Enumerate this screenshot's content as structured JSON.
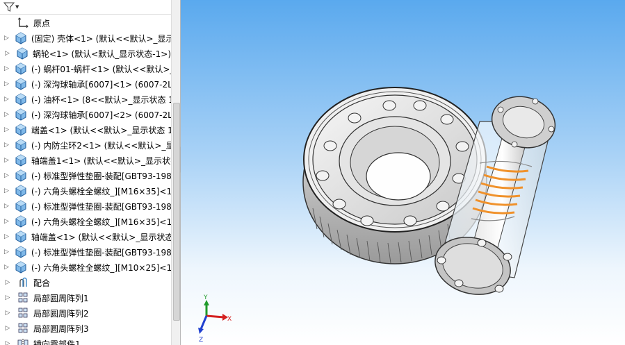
{
  "filter": {
    "icon": "filter-icon"
  },
  "tree": {
    "items": [
      {
        "label": "原点",
        "icon": "origin-icon",
        "expandable": false
      },
      {
        "label": "(固定) 壳体<1> (默认<<默认>_显示",
        "icon": "part-icon",
        "expandable": true
      },
      {
        "label": "蜗轮<1> (默认<默认_显示状态-1>)",
        "icon": "part-icon",
        "expandable": true
      },
      {
        "label": "(-) 蜗杆01-蜗杆<1> (默认<<默认>_",
        "icon": "part-icon",
        "expandable": true
      },
      {
        "label": "(-) 深沟球轴承[6007]<1> (6007-2LS",
        "icon": "part-icon",
        "expandable": true
      },
      {
        "label": "(-) 油杯<1> (8<<默认>_显示状态 1",
        "icon": "part-icon",
        "expandable": true
      },
      {
        "label": "(-) 深沟球轴承[6007]<2> (6007-2LS",
        "icon": "part-icon",
        "expandable": true
      },
      {
        "label": "端盖<1> (默认<<默认>_显示状态 1",
        "icon": "part-icon",
        "expandable": true
      },
      {
        "label": "(-) 内防尘环2<1> (默认<<默认>_显",
        "icon": "part-icon",
        "expandable": true
      },
      {
        "label": "轴端盖1<1> (默认<<默认>_显示状态",
        "icon": "part-icon",
        "expandable": true
      },
      {
        "label": "(-) 标准型弹性垫圈-装配[GBT93-198",
        "icon": "part-icon",
        "expandable": true
      },
      {
        "label": "(-) 六角头螺栓全螺纹_][M16×35]<1",
        "icon": "part-icon",
        "expandable": true
      },
      {
        "label": "(-) 标准型弹性垫圈-装配[GBT93-198",
        "icon": "part-icon",
        "expandable": true
      },
      {
        "label": "(-) 六角头螺栓全螺纹_][M16×35]<1",
        "icon": "part-icon",
        "expandable": true
      },
      {
        "label": "轴端盖<1> (默认<<默认>_显示状态",
        "icon": "part-icon",
        "expandable": true
      },
      {
        "label": "(-) 标准型弹性垫圈-装配[GBT93-198",
        "icon": "part-icon",
        "expandable": true
      },
      {
        "label": "(-) 六角头螺栓全螺纹_][M10×25]<1",
        "icon": "part-icon",
        "expandable": true
      },
      {
        "label": "配合",
        "icon": "mates-icon",
        "expandable": true
      },
      {
        "label": "局部圆周阵列1",
        "icon": "circular-pattern-icon",
        "expandable": true
      },
      {
        "label": "局部圆周阵列2",
        "icon": "circular-pattern-icon",
        "expandable": true
      },
      {
        "label": "局部圆周阵列3",
        "icon": "circular-pattern-icon",
        "expandable": true
      },
      {
        "label": "镜向零部件1",
        "icon": "mirror-icon",
        "expandable": true
      }
    ]
  },
  "triad": {
    "x_label": "X",
    "y_label": "Y",
    "z_label": "Z"
  },
  "colors": {
    "part_icon": "#3a86c8",
    "viewport_top": "#5aa9ee",
    "viewport_bottom": "#ffffff",
    "spring": "#f0912a",
    "axis_x": "#d42020",
    "axis_y": "#1f9a2a",
    "axis_z": "#2040d0"
  }
}
